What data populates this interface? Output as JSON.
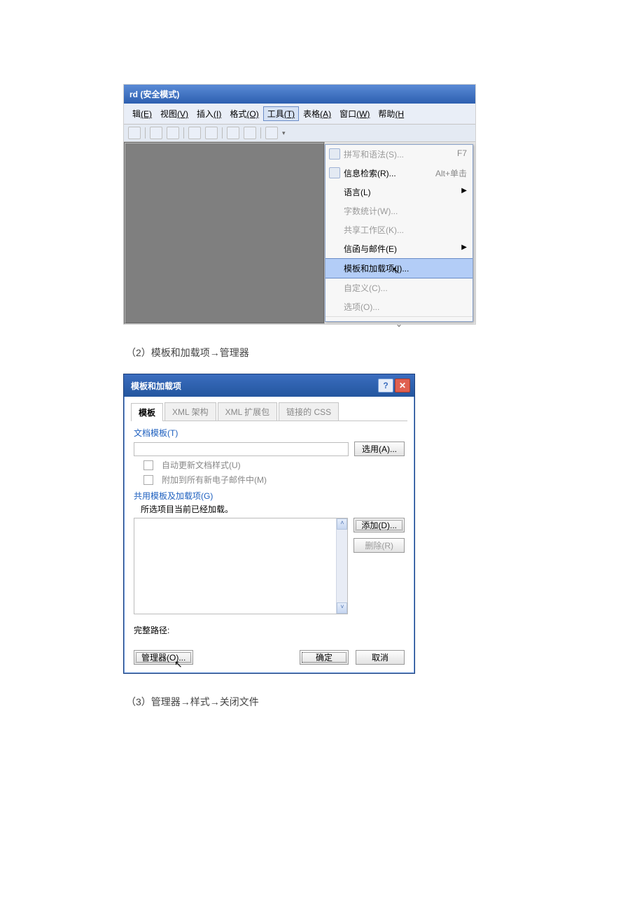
{
  "screenshot1": {
    "title_suffix": "rd (安全模式)",
    "menus": [
      {
        "label": "辑",
        "key": "(E)"
      },
      {
        "label": "视图",
        "key": "(V)"
      },
      {
        "label": "插入",
        "key": "(I)"
      },
      {
        "label": "格式",
        "key": "(O)"
      },
      {
        "label": "工具",
        "key": "(T)",
        "active": true
      },
      {
        "label": "表格",
        "key": "(A)"
      },
      {
        "label": "窗口",
        "key": "(W)"
      },
      {
        "label": "帮助",
        "key": "(H"
      }
    ],
    "dropdown": [
      {
        "label": "拼写和语法(S)...",
        "shortcut": "F7",
        "dis": true,
        "icon": true
      },
      {
        "label": "信息检索(R)...",
        "shortcut": "Alt+单击",
        "icon": true
      },
      {
        "label": "语言(L)",
        "arrow": true
      },
      {
        "label": "字数统计(W)...",
        "dis": true
      },
      {
        "label": "共享工作区(K)...",
        "dis": true
      },
      {
        "label": "信函与邮件(E)",
        "arrow": true
      },
      {
        "label": "模板和加载项(I)...",
        "highlight": true
      },
      {
        "label": "自定义(C)...",
        "dis": true
      },
      {
        "label": "选项(O)...",
        "dis": true
      }
    ]
  },
  "caption2": "（2）模板和加载项→管理器",
  "dialog": {
    "title": "模板和加载项",
    "tabs": [
      "模板",
      "XML 架构",
      "XML 扩展包",
      "链接的 CSS"
    ],
    "section1_label": "文档模板(T)",
    "select_btn": "选用(A)...",
    "ck1": "自动更新文档样式(U)",
    "ck2": "附加到所有新电子邮件中(M)",
    "section2_label": "共用模板及加载项(G)",
    "loaded_text": "所选项目当前已经加载。",
    "add_btn": "添加(D)...",
    "del_btn": "删除(R)",
    "path_label": "完整路径:",
    "manager_btn": "管理器(O)...",
    "ok_btn": "确定",
    "cancel_btn": "取消"
  },
  "caption3": "（3）管理器→样式→关闭文件"
}
